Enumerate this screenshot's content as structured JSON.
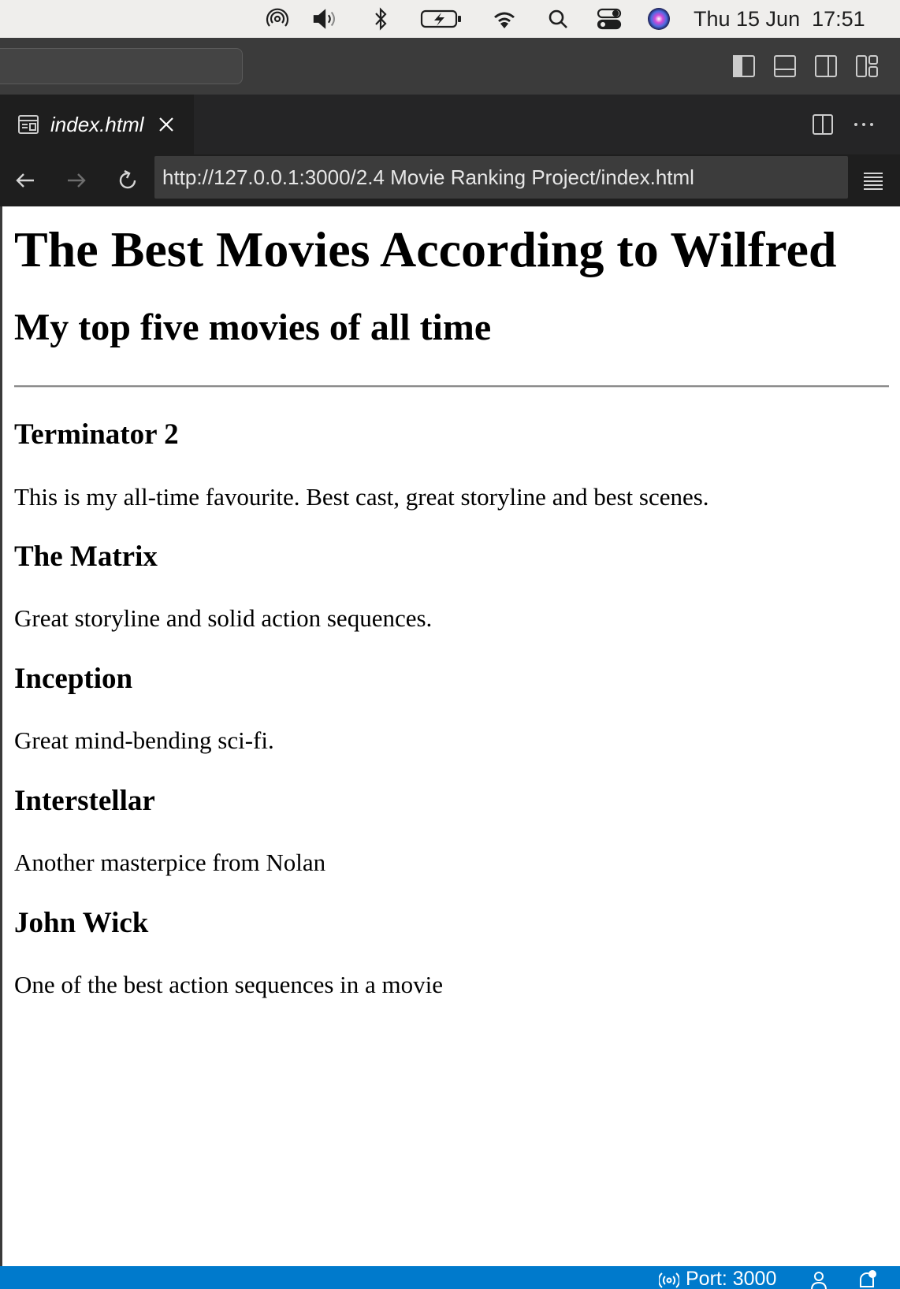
{
  "menubar": {
    "clock": "Thu 15 Jun  17:51",
    "icons": [
      "airdrop-icon",
      "volume-icon",
      "bluetooth-icon",
      "battery-charging-icon",
      "wifi-icon",
      "spotlight-search-icon",
      "control-center-icon",
      "siri-icon"
    ]
  },
  "titlebar": {
    "layout_icons": [
      "toggle-primary-sidebar-icon",
      "toggle-panel-icon",
      "toggle-secondary-sidebar-icon",
      "customize-layout-icon"
    ]
  },
  "tabs": [
    {
      "label": "index.html",
      "icon": "preview-file-icon",
      "active": true
    }
  ],
  "tab_actions": [
    "split-editor-icon",
    "more-actions-icon"
  ],
  "browser": {
    "url": "http://127.0.0.1:3000/2.4 Movie Ranking Project/index.html",
    "buttons": [
      "back-arrow-icon",
      "forward-arrow-icon",
      "reload-icon",
      "menu-icon"
    ]
  },
  "page": {
    "title": "The Best Movies According to Wilfred",
    "subtitle": "My top five movies of all time",
    "movies": [
      {
        "title": "Terminator 2",
        "description": "This is my all-time favourite. Best cast, great storyline and best scenes."
      },
      {
        "title": "The Matrix",
        "description": "Great storyline and solid action sequences."
      },
      {
        "title": "Inception",
        "description": "Great mind-bending sci-fi."
      },
      {
        "title": "Interstellar",
        "description": "Another masterpice from Nolan"
      },
      {
        "title": "John Wick",
        "description": "One of the best action sequences in a movie"
      }
    ]
  },
  "statusbar": {
    "port_label": "Port: 3000",
    "icons": [
      "broadcast-icon",
      "accounts-icon",
      "notifications-bell-icon"
    ]
  },
  "colors": {
    "statusbar": "#007acc",
    "editor_bg": "#1e1e1e",
    "titlebar_bg": "#3b3b3b",
    "menubar_bg": "#efeeec"
  }
}
